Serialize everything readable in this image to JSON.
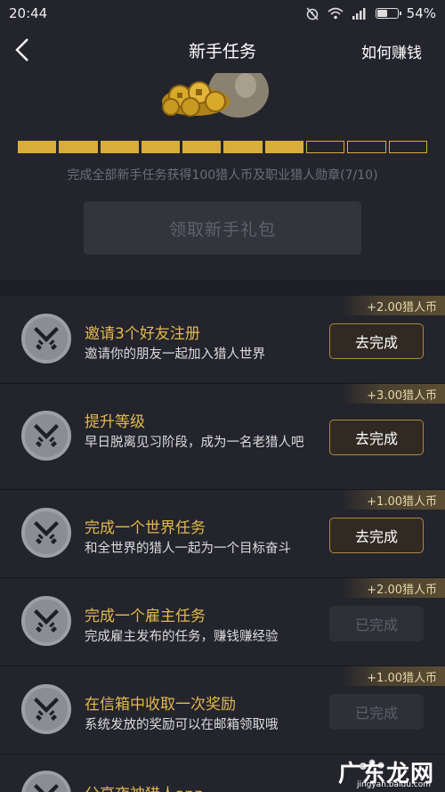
{
  "status_bar": {
    "time": "20:44",
    "battery": "54%",
    "battery_level": 0.54,
    "icons": [
      "alarm-off-icon",
      "wifi-icon",
      "signal-icon",
      "battery-icon"
    ]
  },
  "nav": {
    "title": "新手任务",
    "right_link": "如何赚钱",
    "back_icon": "chevron-left-icon"
  },
  "progress": {
    "completed": 7,
    "total": 10,
    "text": "完成全部新手任务获得100猎人币及职业猎人勋章(7/10)",
    "color": "#d9ad3c"
  },
  "claim_button": "领取新手礼包",
  "tasks": [
    {
      "title": "邀请3个好友注册",
      "desc": "邀请你的朋友一起加入猎人世界",
      "reward": "+2.00猎人币",
      "action": "去完成",
      "done": false
    },
    {
      "title": "提升等级",
      "desc": "早日脱离见习阶段，成为一名老猎人吧",
      "reward": "+3.00猎人币",
      "action": "去完成",
      "done": false
    },
    {
      "title": "完成一个世界任务",
      "desc": "和全世界的猎人一起为一个目标奋斗",
      "reward": "+1.00猎人币",
      "action": "去完成",
      "done": false
    },
    {
      "title": "完成一个雇主任务",
      "desc": "完成雇主发布的任务，赚钱赚经验",
      "reward": "+2.00猎人币",
      "action": "已完成",
      "done": true
    },
    {
      "title": "在信箱中收取一次奖励",
      "desc": "系统发放的奖励可以在邮箱领取哦",
      "reward": "+1.00猎人币",
      "action": "已完成",
      "done": true
    },
    {
      "title": "分享夜神猎人app"
    }
  ],
  "watermark": {
    "text": "广东龙网",
    "sub": "jingyan.baidu.com"
  },
  "colors": {
    "accent": "#e3b84d",
    "background": "#1e1f26",
    "panel": "#23242c"
  }
}
